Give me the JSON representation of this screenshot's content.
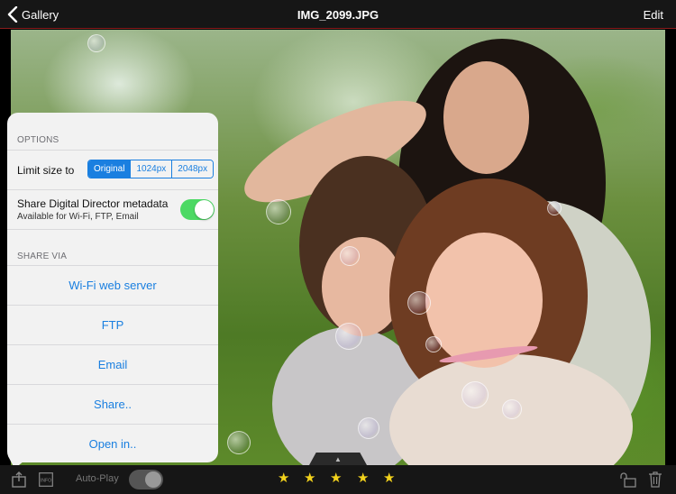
{
  "header": {
    "back_label": "Gallery",
    "title": "IMG_2099.JPG",
    "edit_label": "Edit"
  },
  "popover": {
    "options_header": "OPTIONS",
    "limit_size_label": "Limit size to",
    "size_options": [
      "Original",
      "1024px",
      "2048px"
    ],
    "selected_size": "Original",
    "metadata_label": "Share Digital Director metadata",
    "metadata_sublabel": "Available for Wi-Fi, FTP, Email",
    "metadata_enabled": true,
    "share_via_header": "SHARE VIA",
    "share_items": [
      "Wi-Fi web server",
      "FTP",
      "Email",
      "Share..",
      "Open in.."
    ]
  },
  "bottom_bar": {
    "info_label": "INFO",
    "autoplay_label": "Auto-Play",
    "autoplay_enabled": false,
    "rating": 5,
    "icons": [
      "share-icon",
      "info-icon",
      "lock-icon",
      "trash-icon"
    ]
  },
  "colors": {
    "accent": "#1a7fe0",
    "toggle_on": "#4cd964",
    "star": "#f2d21c"
  }
}
